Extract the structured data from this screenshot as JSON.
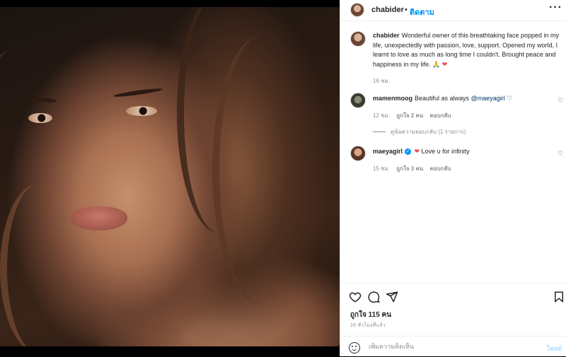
{
  "post": {
    "photo_alt": "",
    "header": {
      "username": "chabider",
      "separator": "•",
      "follow_label": "ติดตาม",
      "more_label": "···"
    },
    "caption": {
      "username": "chabider",
      "text": "Wonderful owner of this breathtaking face popped in my life, unexpectedly with passion, love, support. Opened my world, I learnt to love as much as long time I couldn't. Brought peace and happiness in my life. 🙏",
      "emoji_end": "❤",
      "time": "16 ชม."
    },
    "comments": [
      {
        "username": "mamenmoog",
        "text": "Beautiful as always",
        "mention": "@maeyagirl",
        "trailing": "♡",
        "time": "12 ชม.",
        "likes": "ถูกใจ 2 คน",
        "reply": "ตอบกลับ",
        "view_replies": "ดูข้อความตอบกลับ (1 รายการ)"
      },
      {
        "username": "maeyagirl",
        "verified_glyph": "✓",
        "heart": "❤",
        "text": "Love u for infinity",
        "time": "15 ชม.",
        "likes": "ถูกใจ 3 คน",
        "reply": "ตอบกลับ"
      }
    ],
    "like_glyph": "♡",
    "likes_count": "ถูกใจ 115 คน",
    "timestamp": "16 ชั่วโมงที่แล้ว",
    "add_comment": {
      "placeholder": "เพิ่มความคิดเห็น",
      "post_label": "โพสต์"
    }
  },
  "icons": [
    "like-icon",
    "comment-icon",
    "share-icon",
    "save-icon",
    "emoji-icon",
    "more-icon"
  ],
  "colors": {
    "accent": "#0095f6",
    "heart_red": "#ed4956",
    "muted_text": "#8e8e8e",
    "post_disabled": "#b2dffc"
  }
}
